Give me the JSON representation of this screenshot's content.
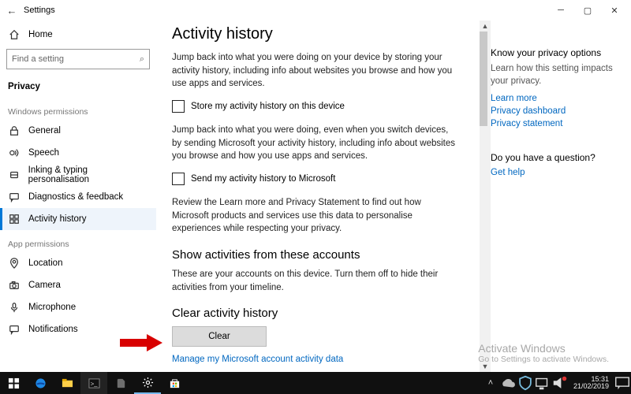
{
  "titlebar": {
    "title": "Settings"
  },
  "sidebar": {
    "home_label": "Home",
    "search_placeholder": "Find a setting",
    "privacy_label": "Privacy",
    "win_perms_heading": "Windows permissions",
    "app_perms_heading": "App permissions",
    "win_items": [
      {
        "label": "General"
      },
      {
        "label": "Speech"
      },
      {
        "label": "Inking & typing personalisation"
      },
      {
        "label": "Diagnostics & feedback"
      },
      {
        "label": "Activity history",
        "selected": true
      }
    ],
    "app_items": [
      {
        "label": "Location"
      },
      {
        "label": "Camera"
      },
      {
        "label": "Microphone"
      },
      {
        "label": "Notifications"
      }
    ]
  },
  "content": {
    "h1": "Activity history",
    "para1": "Jump back into what you were doing on your device by storing your activity history, including info about websites you browse and how you use apps and services.",
    "check1": "Store my activity history on this device",
    "para2": "Jump back into what you were doing, even when you switch devices, by sending Microsoft your activity history, including info about websites you browse and how you use apps and services.",
    "check2": "Send my activity history to Microsoft",
    "para3": "Review the Learn more and Privacy Statement to find out how Microsoft products and services use this data to personalise experiences while respecting your privacy.",
    "accounts_heading": "Show activities from these accounts",
    "accounts_para": "These are your accounts on this device. Turn them off to hide their activities from your timeline.",
    "clear_heading": "Clear activity history",
    "clear_button": "Clear",
    "manage_link": "Manage my Microsoft account activity data"
  },
  "rightcol": {
    "privacy_heading": "Know your privacy options",
    "privacy_para": "Learn how this setting impacts your privacy.",
    "link_learn": "Learn more",
    "link_dashboard": "Privacy dashboard",
    "link_statement": "Privacy statement",
    "question_heading": "Do you have a question?",
    "link_help": "Get help"
  },
  "watermark": {
    "line1": "Activate Windows",
    "line2": "Go to Settings to activate Windows."
  },
  "taskbar": {
    "time": "15:31",
    "date": "21/02/2019"
  }
}
